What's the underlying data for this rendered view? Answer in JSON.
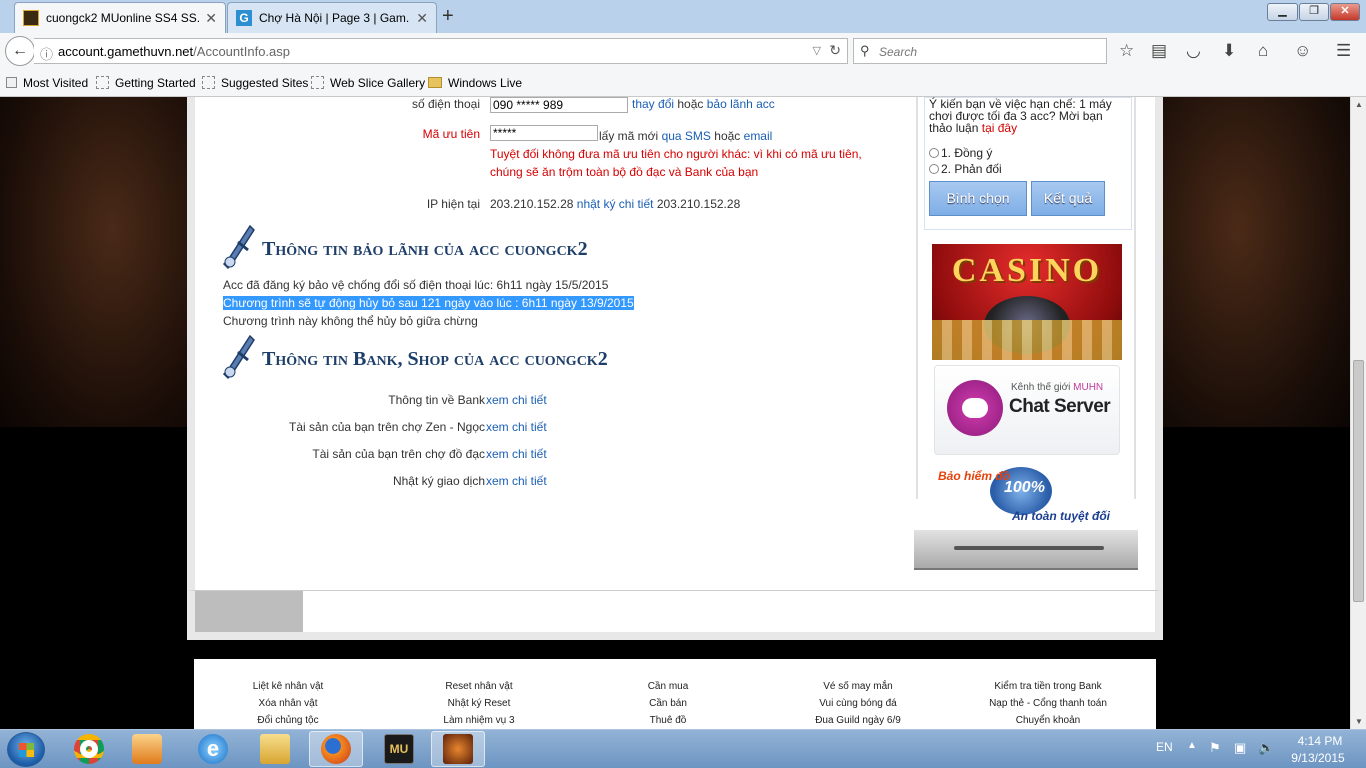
{
  "browser": {
    "tabs": [
      {
        "title": "cuongck2 MUonline SS4 SS...",
        "active": true
      },
      {
        "title": "Chợ Hà Nội | Page 3 | Gam...",
        "active": false
      }
    ],
    "url_domain": "account.gamethuvn.net",
    "url_path": "/AccountInfo.asp",
    "search_placeholder": "Search",
    "bookmarks": [
      "Most Visited",
      "Getting Started",
      "Suggested Sites",
      "Web Slice Gallery",
      "Windows Live"
    ]
  },
  "account": {
    "phone_label": "số điện thoại",
    "phone_value": "090 ***** 989",
    "phone_change": "thay đổi",
    "or1": "hoặc",
    "guarantee_link": "bảo lãnh acc",
    "priority_label": "Mã ưu tiên",
    "priority_value": "*****",
    "get_new": "lấy mã mới",
    "via_sms": "qua SMS",
    "or2": "hoặc",
    "email": "email",
    "warning_line1": "Tuyệt đối không đưa mã ưu tiên cho người khác: vì khi có mã ưu tiên,",
    "warning_line2": "chúng sẽ ăn trộm toàn bộ đồ đạc và Bank của bạn",
    "ip_label": "IP hiện tại",
    "ip_value": "203.210.152.28",
    "ip_log": "nhật ký chi tiết",
    "ip_value2": "203.210.152.28"
  },
  "guarantee": {
    "heading": "Thông tin bảo lãnh của acc cuongck2",
    "line1": "Acc đã đăng ký bảo vệ chống đổi số điện thoại lúc: 6h11 ngày 15/5/2015",
    "line2": "Chương trình sẽ tự động hủy bỏ sau 121 ngày vào lúc : 6h11 ngày 13/9/2015",
    "line3": "Chương trình này không thể hủy bỏ giữa chừng"
  },
  "bank": {
    "heading": "Thông tin Bank, Shop của acc cuongck2",
    "view": "xem chi tiết",
    "rows": [
      "Thông tin về Bank",
      "Tài sản của bạn trên chợ Zen - Ngọc",
      "Tài sản của bạn trên chợ đồ đạc",
      "Nhật ký giao dịch"
    ]
  },
  "poll": {
    "question": "Ý kiến bạn về việc hạn chế: 1 máy chơi được tối đa 3 acc? Mời bạn thảo luận",
    "here": "tại đây",
    "option1": "1. Đồng ý",
    "option2": "2. Phản đối",
    "vote": "Bình chọn",
    "result": "Kết quả"
  },
  "ads": {
    "casino": "CASINO",
    "channel": "Kênh thế giới",
    "muhn": "MUHN",
    "chat": "Chat Server",
    "insurance": "Bảo hiểm đồ",
    "percent": "100%",
    "safe": "An toàn tuyệt đối"
  },
  "footer": {
    "columns": [
      [
        "Liệt kê nhân vật",
        "Xóa nhân vật",
        "Đổi chủng tộc"
      ],
      [
        "Reset nhân vật",
        "Nhật ký Reset",
        "Làm nhiệm vụ 3"
      ],
      [
        "Cần mua",
        "Cần bán",
        "Thuê đồ"
      ],
      [
        "Vé số may mắn",
        "Vui cùng bóng đá",
        "Đua Guild ngày 6/9"
      ],
      [
        "Kiểm tra tiền trong Bank",
        "Nạp thẻ - Cổng thanh toán",
        "Chuyển khoản"
      ]
    ]
  },
  "taskbar": {
    "lang": "EN",
    "time": "4:14 PM",
    "date": "9/13/2015"
  }
}
